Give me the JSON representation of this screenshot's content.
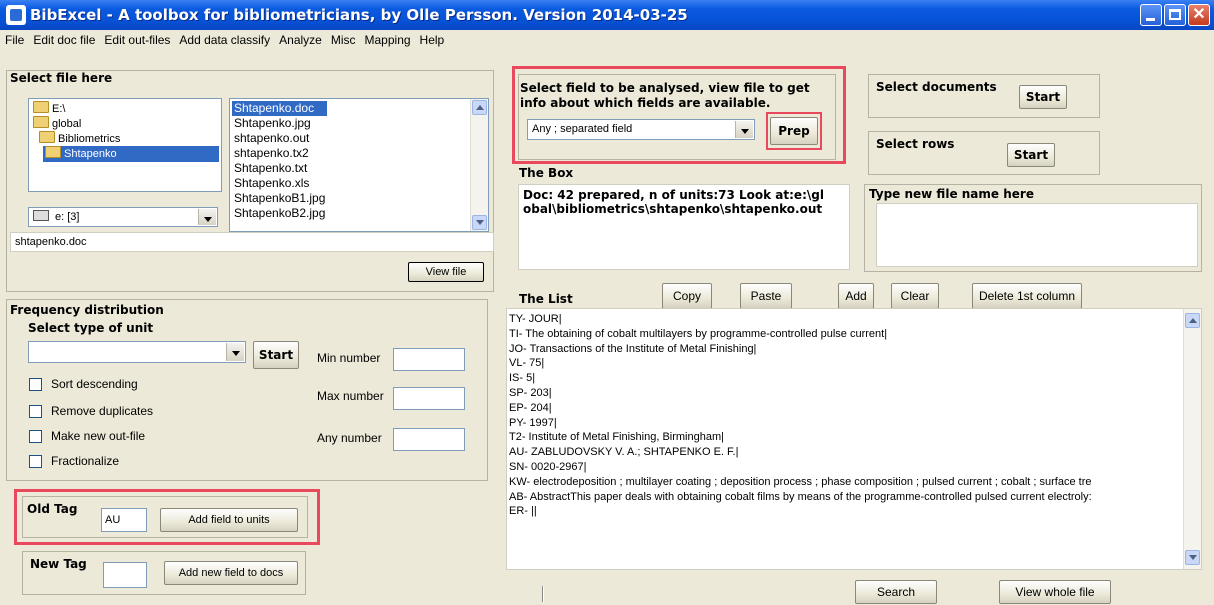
{
  "window": {
    "title": "BibExcel - A toolbox for bibliometricians, by Olle Persson. Version 2014-03-25"
  },
  "menu": [
    "File",
    "Edit doc file",
    "Edit out-files",
    "Add data classify",
    "Analyze",
    "Misc",
    "Mapping",
    "Help"
  ],
  "select_file": {
    "heading": "Select file here",
    "folders": [
      "E:\\",
      "global",
      "Bibliometrics",
      "Shtapenko"
    ],
    "drive": "e: [3]",
    "files": [
      "Shtapenko.doc",
      "Shtapenko.jpg",
      "shtapenko.out",
      "shtapenko.tx2",
      "Shtapenko.txt",
      "Shtapenko.xls",
      "ShtapenkoB1.jpg",
      "ShtapenkoB2.jpg"
    ],
    "path_value": "shtapenko.doc",
    "view_file_label": "View file"
  },
  "frequency": {
    "heading": "Frequency distribution",
    "select_unit_label": "Select type of unit",
    "start_label": "Start",
    "min_label": "Min number",
    "max_label": "Max number",
    "any_label": "Any number",
    "checkboxes": [
      "Sort descending",
      "Remove duplicates",
      "Make new out-file",
      "Fractionalize"
    ]
  },
  "old_tag": {
    "label": "Old Tag",
    "value": "AU",
    "button": "Add field to units"
  },
  "new_tag": {
    "label": "New Tag",
    "value": "",
    "button": "Add new field to docs"
  },
  "analyse": {
    "instruction": "Select field to be analysed, view file to get info about which fields are available.",
    "field_value": "Any ; separated field",
    "prep_label": "Prep"
  },
  "select_documents": {
    "label": "Select documents",
    "start_label": "Start"
  },
  "select_rows": {
    "label": "Select rows",
    "start_label": "Start"
  },
  "the_box": {
    "heading": "The Box",
    "text": "Doc: 42 prepared, n of units:73 Look at:e:\\global\\bibliometrics\\shtapenko\\shtapenko.out"
  },
  "new_file_name": {
    "heading": "Type new file name here",
    "value": ""
  },
  "the_list": {
    "heading": "The List",
    "buttons": {
      "copy": "Copy",
      "paste": "Paste",
      "add": "Add",
      "clear": "Clear",
      "delete_first": "Delete 1st column"
    },
    "lines": [
      "TY- JOUR|",
      "TI- The obtaining of cobalt multilayers by programme-controlled pulse current|",
      "JO- Transactions of the Institute of Metal Finishing|",
      "VL- 75|",
      "IS- 5|",
      "SP- 203|",
      "EP- 204|",
      "PY- 1997|",
      "T2- Institute of Metal Finishing, Birmingham|",
      "AU- ZABLUDOVSKY V. A.; SHTAPENKO E. F.|",
      "SN- 0020-2967|",
      "KW- electrodeposition ; multilayer coating ; deposition process ; phase composition ; pulsed current ; cobalt ; surface tre",
      "AB- AbstractThis paper deals with obtaining cobalt films by means of the programme-controlled pulsed current electroly:",
      "ER- ||"
    ],
    "search_label": "Search",
    "view_whole_label": "View whole file"
  }
}
